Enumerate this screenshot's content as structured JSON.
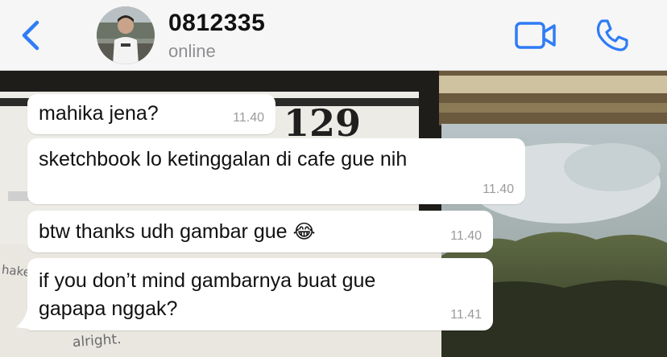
{
  "header": {
    "contact_name": "0812335",
    "status": "online",
    "back_icon": "chevron-left-icon",
    "video_icon": "video-camera-icon",
    "call_icon": "phone-icon",
    "accent_color": "#2f7cf6"
  },
  "messages": [
    {
      "text": "mahika jena?",
      "time": "11.40"
    },
    {
      "text": "sketchbook lo ketinggalan di cafe gue nih",
      "time": "11.40"
    },
    {
      "text": "btw thanks udh gambar gue",
      "emoji": "😂",
      "time": "11.40"
    },
    {
      "line1": "if you don’t mind gambarnya buat gue",
      "line2": "gapapa nggak?",
      "time": "11.41"
    }
  ],
  "wallpaper": {
    "sign_text": "129",
    "handwriting_1": "hake",
    "handwriting_2": "alright."
  }
}
